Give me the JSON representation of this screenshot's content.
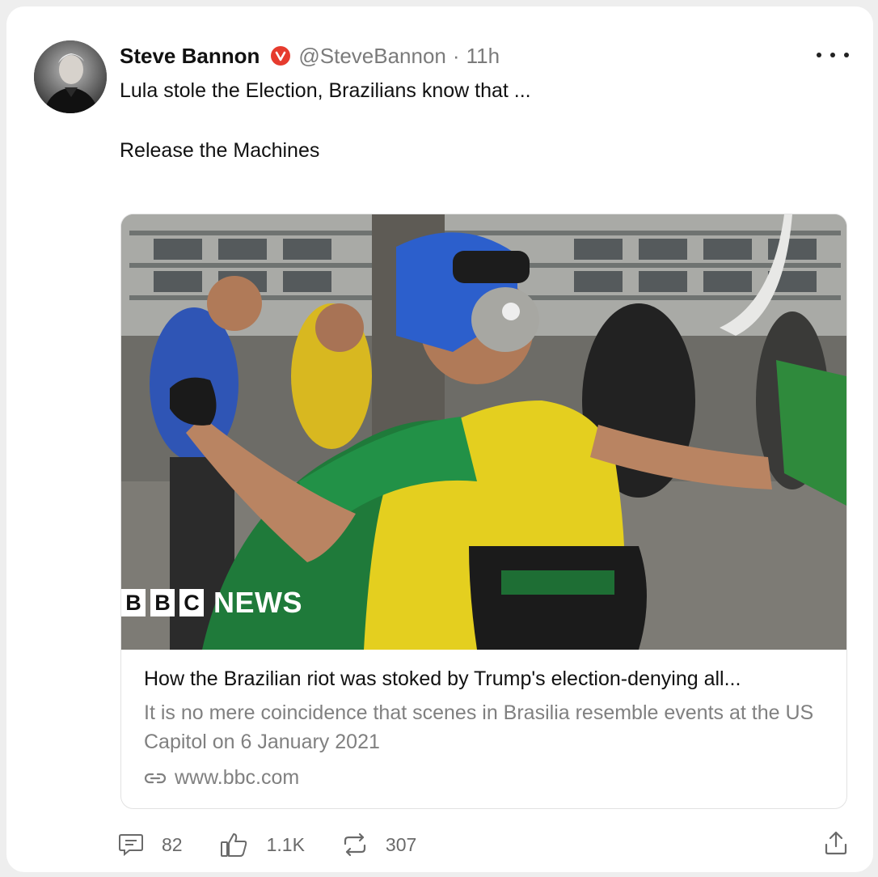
{
  "post": {
    "author_name": "Steve Bannon",
    "author_handle": "@SteveBannon",
    "separator": "·",
    "time": "11h",
    "verified_badge_icon": "verified-badge-icon",
    "text_lines": [
      "Lula stole the Election, Brazilians know that ...",
      "Release the Machines"
    ]
  },
  "link_preview": {
    "image_overlay_logo": {
      "letters": [
        "B",
        "B",
        "C"
      ],
      "word": "NEWS"
    },
    "title": "How the Brazilian riot was stoked by Trump's election-denying all...",
    "description": "It is no mere coincidence that scenes in Brasilia resemble events at the US Capitol on 6 January 2021",
    "domain": "www.bbc.com"
  },
  "actions": {
    "comments": "82",
    "likes": "1.1K",
    "reposts": "307"
  },
  "colors": {
    "badge": "#e63b2e",
    "muted_text": "#7b7b7b"
  }
}
